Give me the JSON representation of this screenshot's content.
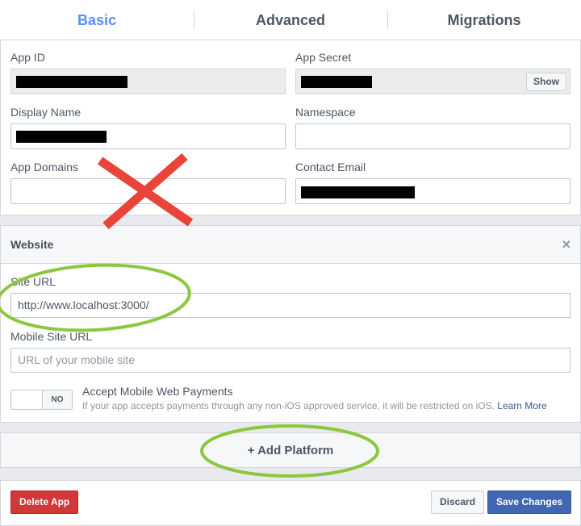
{
  "tabs": [
    {
      "label": "Basic",
      "active": true
    },
    {
      "label": "Advanced",
      "active": false
    },
    {
      "label": "Migrations",
      "active": false
    }
  ],
  "basic": {
    "app_id_label": "App ID",
    "app_secret_label": "App Secret",
    "show_label": "Show",
    "display_name_label": "Display Name",
    "namespace_label": "Namespace",
    "app_domains_label": "App Domains",
    "contact_email_label": "Contact Email"
  },
  "website": {
    "title": "Website",
    "close_label": "×",
    "site_url_label": "Site URL",
    "site_url_value": "http://www.localhost:3000/",
    "mobile_site_url_label": "Mobile Site URL",
    "mobile_site_url_placeholder": "URL of your mobile site",
    "toggle_label": "NO",
    "payments_title": "Accept Mobile Web Payments",
    "payments_desc": "If your app accepts payments through any non-iOS approved service, it will be restricted on iOS.",
    "learn_more": "Learn More"
  },
  "add_platform_label": "+ Add Platform",
  "footer": {
    "delete_label": "Delete App",
    "discard_label": "Discard",
    "save_label": "Save Changes"
  },
  "colors": {
    "accent": "#5890ff",
    "annotation_red": "#e8443a",
    "annotation_green": "#8dc63f"
  }
}
